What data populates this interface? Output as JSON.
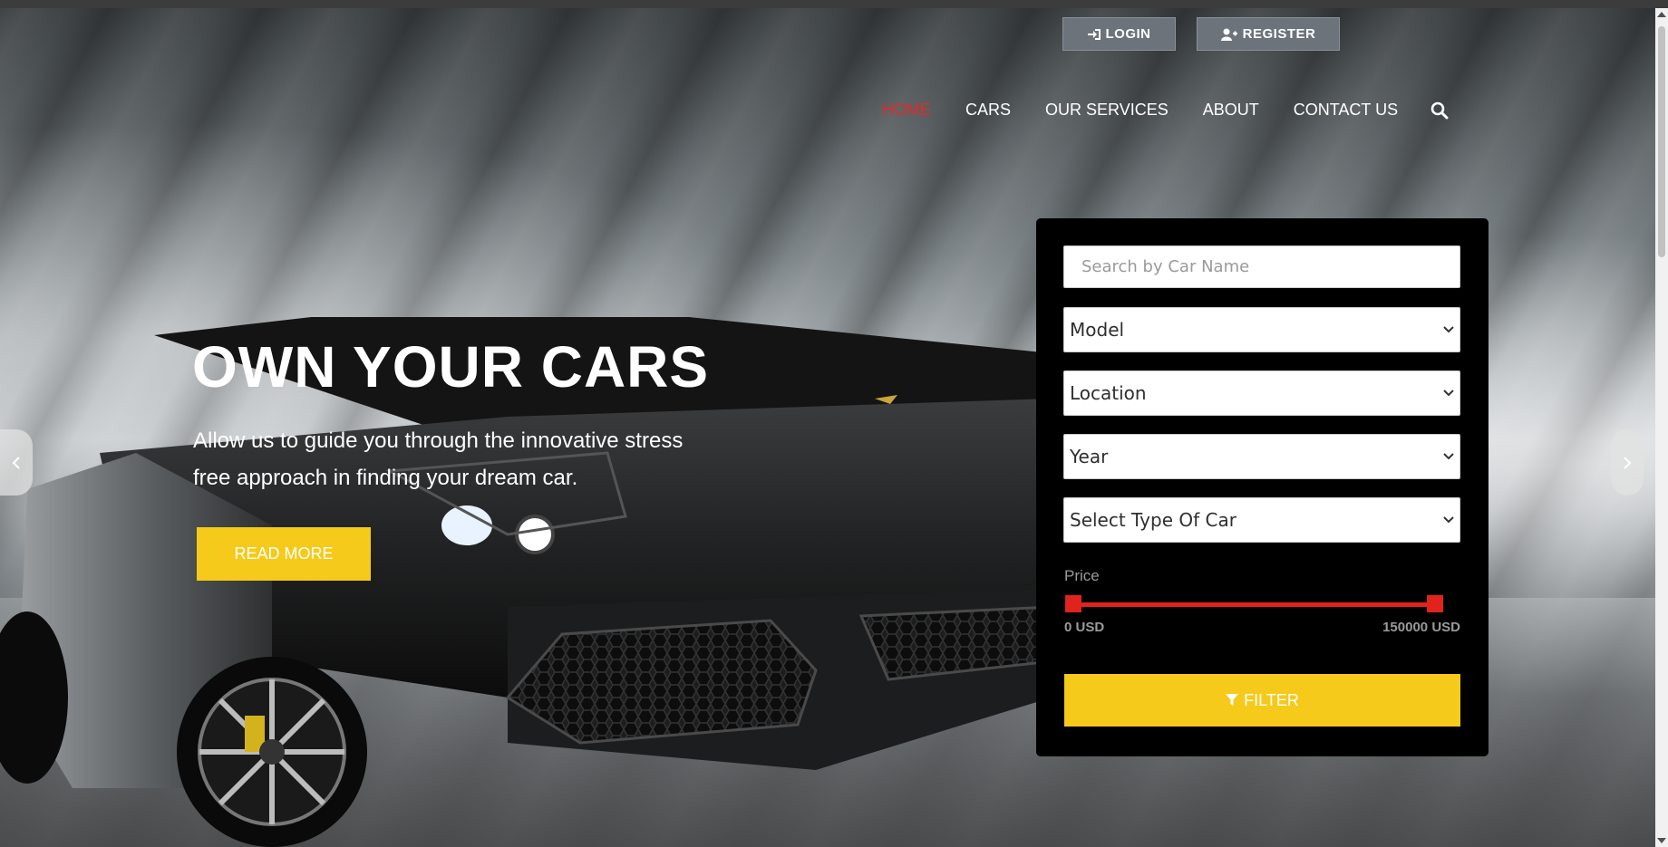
{
  "auth": {
    "login_label": "LOGIN",
    "register_label": "REGISTER"
  },
  "nav": {
    "items": [
      {
        "label": "HOME",
        "active": true
      },
      {
        "label": "CARS",
        "active": false
      },
      {
        "label": "OUR SERVICES",
        "active": false
      },
      {
        "label": "ABOUT",
        "active": false
      },
      {
        "label": "CONTACT US",
        "active": false
      }
    ],
    "search_icon": "search-icon"
  },
  "hero": {
    "title": "OWN YOUR CARS",
    "subtitle": "Allow us to guide you through the innovative stress free approach in finding your dream car.",
    "read_more_label": "READ MORE"
  },
  "filter": {
    "search_placeholder": "Search by Car Name",
    "model_selected": "Model",
    "location_selected": "Location",
    "year_selected": "Year",
    "type_selected": "Select Type Of Car",
    "price_label": "Price",
    "price_min_label": "0 USD",
    "price_max_label": "150000 USD",
    "price_min": 0,
    "price_max": 150000,
    "filter_label": "FILTER"
  },
  "colors": {
    "accent_yellow": "#f5ca1a",
    "active_red": "#e32a2a",
    "range_red": "#e0231c",
    "auth_button_gray": "#6c737b"
  }
}
